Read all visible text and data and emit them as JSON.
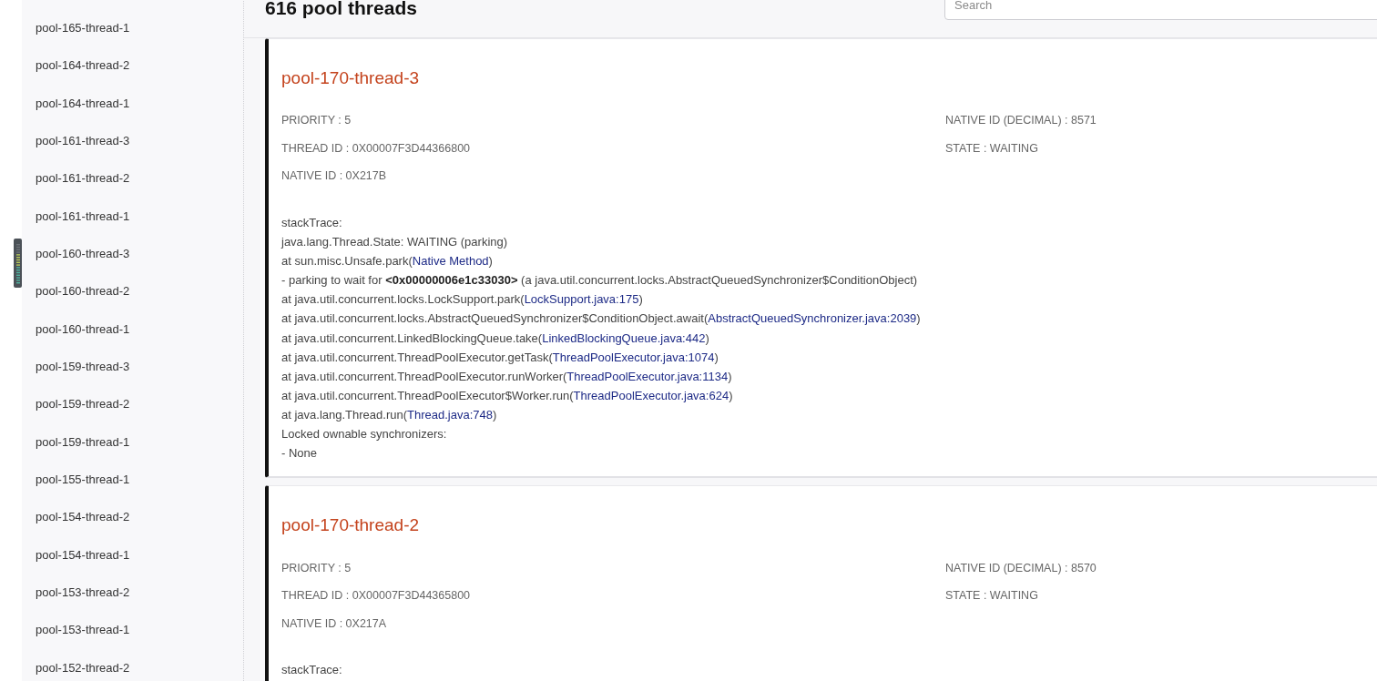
{
  "header": {
    "title": "616 pool threads",
    "search": {
      "placeholder": "Search"
    }
  },
  "sidebar": {
    "items": [
      {
        "label": "pool-165-thread-1"
      },
      {
        "label": "pool-164-thread-2"
      },
      {
        "label": "pool-164-thread-1"
      },
      {
        "label": "pool-161-thread-3"
      },
      {
        "label": "pool-161-thread-2"
      },
      {
        "label": "pool-161-thread-1"
      },
      {
        "label": "pool-160-thread-3"
      },
      {
        "label": "pool-160-thread-2"
      },
      {
        "label": "pool-160-thread-1"
      },
      {
        "label": "pool-159-thread-3"
      },
      {
        "label": "pool-159-thread-2"
      },
      {
        "label": "pool-159-thread-1"
      },
      {
        "label": "pool-155-thread-1"
      },
      {
        "label": "pool-154-thread-2"
      },
      {
        "label": "pool-154-thread-1"
      },
      {
        "label": "pool-153-thread-2"
      },
      {
        "label": "pool-153-thread-1"
      },
      {
        "label": "pool-152-thread-2"
      }
    ]
  },
  "threads": [
    {
      "name": "pool-170-thread-3",
      "properties_left": [
        "PRIORITY : 5",
        "THREAD ID : 0X00007F3D44366800",
        "NATIVE ID : 0X217B"
      ],
      "properties_right": [
        "NATIVE ID (DECIMAL) : 8571",
        "STATE : WAITING"
      ],
      "stack_trace": [
        {
          "text": "stackTrace:"
        },
        {
          "text": "java.lang.Thread.State: WAITING (parking)"
        },
        {
          "text": "at sun.misc.Unsafe.park(",
          "link": "Native Method",
          "tail": ")"
        },
        {
          "text": "- parking to wait for **<0x00000006e1c33030>** (a java.util.concurrent.locks.AbstractQueuedSynchronizer$ConditionObject)"
        },
        {
          "text": "at java.util.concurrent.locks.LockSupport.park(",
          "link": "LockSupport.java:175",
          "tail": ")"
        },
        {
          "text": "at java.util.concurrent.locks.AbstractQueuedSynchronizer$ConditionObject.await(",
          "link": "AbstractQueuedSynchronizer.java:2039",
          "tail": ")"
        },
        {
          "text": "at java.util.concurrent.LinkedBlockingQueue.take(",
          "link": "LinkedBlockingQueue.java:442",
          "tail": ")"
        },
        {
          "text": "at java.util.concurrent.ThreadPoolExecutor.getTask(",
          "link": "ThreadPoolExecutor.java:1074",
          "tail": ")"
        },
        {
          "text": "at java.util.concurrent.ThreadPoolExecutor.runWorker(",
          "link": "ThreadPoolExecutor.java:1134",
          "tail": ")"
        },
        {
          "text": "at java.util.concurrent.ThreadPoolExecutor$Worker.run(",
          "link": "ThreadPoolExecutor.java:624",
          "tail": ")"
        },
        {
          "text": "at java.lang.Thread.run(",
          "link": "Thread.java:748",
          "tail": ")"
        },
        {
          "text": "Locked ownable synchronizers:"
        },
        {
          "text": "- None"
        }
      ]
    },
    {
      "name": "pool-170-thread-2",
      "properties_left": [
        "PRIORITY : 5",
        "THREAD ID : 0X00007F3D44365800",
        "NATIVE ID : 0X217A"
      ],
      "properties_right": [
        "NATIVE ID (DECIMAL) : 8570",
        "STATE : WAITING"
      ],
      "stack_trace": [
        {
          "text": "stackTrace:"
        }
      ]
    }
  ]
}
